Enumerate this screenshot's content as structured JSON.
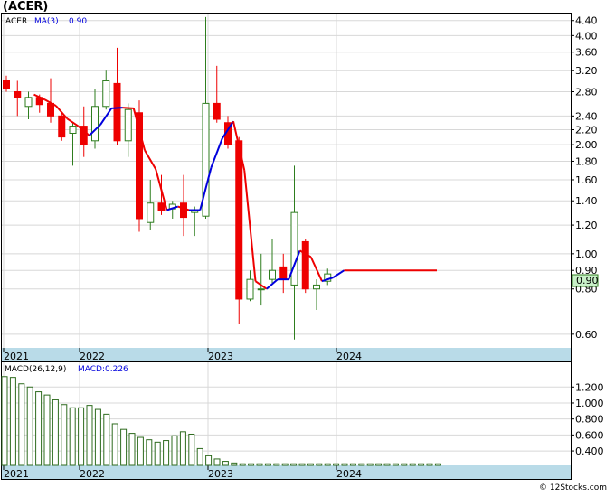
{
  "chart_data": [
    {
      "type": "candlestick",
      "title": "(ACER)",
      "indicator_label": "MA(3)",
      "indicator_value": "0.90",
      "last_price_label": "0.90",
      "y_scale": "log",
      "ylim": [
        0.55,
        4.6
      ],
      "y_ticks": [
        "4.40",
        "4.00",
        "3.60",
        "3.20",
        "2.80",
        "2.40",
        "2.20",
        "2.00",
        "1.80",
        "1.60",
        "1.40",
        "1.20",
        "1.00",
        "0.90",
        "0.80",
        "0.60"
      ],
      "x_tick_labels": [
        "2021",
        "2022",
        "2023",
        "2024"
      ],
      "grid": true,
      "colors": {
        "up": "#2e7d1e",
        "down": "#ee0000",
        "ma_falling": "#ee0000",
        "ma_rising": "#0000dd",
        "x_band": "#b9dbe8"
      },
      "candles": [
        {
          "o": 3.0,
          "h": 3.1,
          "l": 2.8,
          "c": 2.85
        },
        {
          "o": 2.8,
          "h": 3.0,
          "l": 2.4,
          "c": 2.7
        },
        {
          "o": 2.55,
          "h": 2.8,
          "l": 2.35,
          "c": 2.7
        },
        {
          "o": 2.7,
          "h": 2.75,
          "l": 2.45,
          "c": 2.58
        },
        {
          "o": 2.6,
          "h": 3.05,
          "l": 2.3,
          "c": 2.4
        },
        {
          "o": 2.4,
          "h": 2.45,
          "l": 2.05,
          "c": 2.1
        },
        {
          "o": 2.15,
          "h": 2.3,
          "l": 1.75,
          "c": 2.25
        },
        {
          "o": 2.25,
          "h": 2.55,
          "l": 1.85,
          "c": 2.0
        },
        {
          "o": 2.05,
          "h": 2.85,
          "l": 1.95,
          "c": 2.55
        },
        {
          "o": 2.55,
          "h": 3.2,
          "l": 2.5,
          "c": 3.0
        },
        {
          "o": 2.95,
          "h": 3.7,
          "l": 2.0,
          "c": 2.05
        },
        {
          "o": 2.05,
          "h": 2.6,
          "l": 1.85,
          "c": 2.5
        },
        {
          "o": 2.45,
          "h": 2.65,
          "l": 1.15,
          "c": 1.25
        },
        {
          "o": 1.22,
          "h": 1.6,
          "l": 1.16,
          "c": 1.38
        },
        {
          "o": 1.38,
          "h": 1.65,
          "l": 1.28,
          "c": 1.32
        },
        {
          "o": 1.33,
          "h": 1.4,
          "l": 1.25,
          "c": 1.37
        },
        {
          "o": 1.38,
          "h": 1.65,
          "l": 1.12,
          "c": 1.26
        },
        {
          "o": 1.3,
          "h": 1.35,
          "l": 1.12,
          "c": 1.32
        },
        {
          "o": 1.27,
          "h": 4.5,
          "l": 1.25,
          "c": 2.6
        },
        {
          "o": 2.6,
          "h": 3.3,
          "l": 2.3,
          "c": 2.35
        },
        {
          "o": 2.3,
          "h": 2.4,
          "l": 1.95,
          "c": 2.0
        },
        {
          "o": 2.05,
          "h": 2.1,
          "l": 0.64,
          "c": 0.75
        },
        {
          "o": 0.75,
          "h": 0.9,
          "l": 0.74,
          "c": 0.85
        },
        {
          "o": 0.8,
          "h": 1.0,
          "l": 0.72,
          "c": 0.8
        },
        {
          "o": 0.85,
          "h": 1.1,
          "l": 0.83,
          "c": 0.9
        },
        {
          "o": 0.92,
          "h": 1.0,
          "l": 0.78,
          "c": 0.85
        },
        {
          "o": 0.82,
          "h": 1.75,
          "l": 0.58,
          "c": 1.3
        },
        {
          "o": 1.08,
          "h": 1.1,
          "l": 0.78,
          "c": 0.8
        },
        {
          "o": 0.8,
          "h": 0.85,
          "l": 0.7,
          "c": 0.82
        },
        {
          "o": 0.84,
          "h": 0.91,
          "l": 0.82,
          "c": 0.88
        }
      ],
      "ma3": [
        null,
        null,
        2.75,
        2.66,
        2.56,
        2.36,
        2.25,
        2.12,
        2.27,
        2.52,
        2.53,
        2.52,
        1.93,
        1.71,
        1.32,
        1.35,
        1.32,
        1.32,
        1.73,
        2.08,
        2.32,
        1.7,
        0.84,
        0.8,
        0.85,
        0.85,
        1.02,
        0.98,
        0.84,
        0.86,
        0.9
      ],
      "ma3_projection_end": 0.9
    },
    {
      "type": "bar",
      "label": "MACD(26,12,9)",
      "value_label": "MACD:0.226",
      "ylim": [
        0.22,
        1.35
      ],
      "y_ticks": [
        "1.200",
        "1.000",
        "0.800",
        "0.600",
        "0.400"
      ],
      "x_tick_labels": [
        "2021",
        "2022",
        "2023",
        "2024"
      ],
      "values": [
        1.33,
        1.32,
        1.24,
        1.2,
        1.14,
        1.1,
        1.04,
        0.98,
        0.94,
        0.94,
        0.97,
        0.92,
        0.86,
        0.74,
        0.67,
        0.62,
        0.57,
        0.54,
        0.51,
        0.53,
        0.59,
        0.64,
        0.61,
        0.43,
        0.34,
        0.3,
        0.27,
        0.25,
        0.24,
        0.24,
        0.24,
        0.24,
        0.24,
        0.24,
        0.24,
        0.24,
        0.24,
        0.24,
        0.24,
        0.24,
        0.24,
        0.24,
        0.24,
        0.24,
        0.24,
        0.24,
        0.24,
        0.24,
        0.24,
        0.24,
        0.24,
        0.24
      ],
      "color": "#2e6b1e"
    }
  ],
  "copyright": "© 12Stocks.com"
}
